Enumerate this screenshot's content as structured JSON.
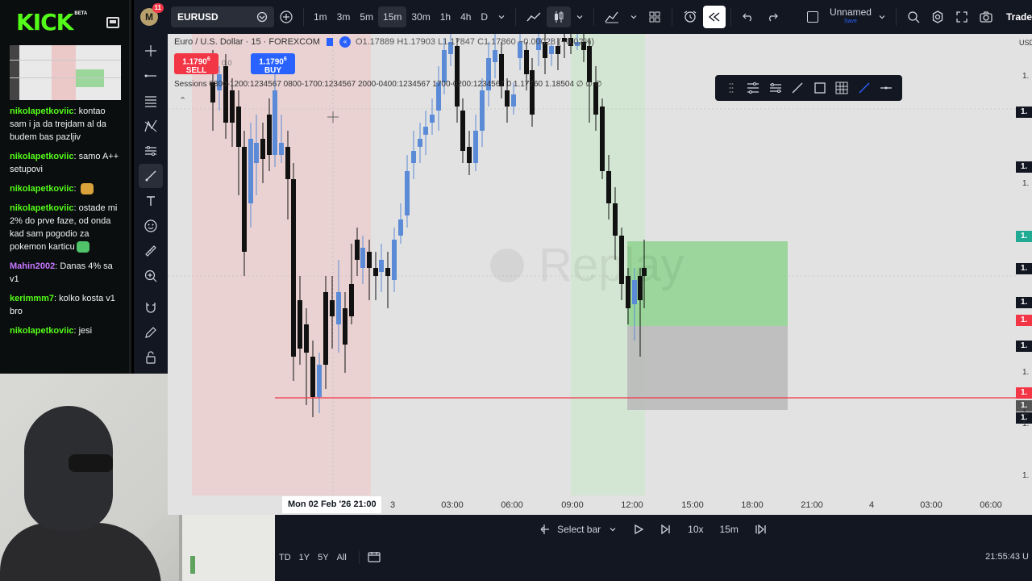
{
  "kick": {
    "logo": "KICK",
    "beta": "BETA",
    "chat": [
      {
        "user": "nikolapetkoviic",
        "color": "#53fc18",
        "text": "kontao sam i ja da trejdam al da budem bas pazljiv"
      },
      {
        "user": "nikolapetkoviic",
        "color": "#53fc18",
        "text": "samo A++ setupovi"
      },
      {
        "user": "nikolapetkoviic",
        "color": "#53fc18",
        "text": ""
      },
      {
        "user": "nikolapetkoviic",
        "color": "#53fc18",
        "text": "ostade mi 2% do prve faze, od onda kad sam pogodio za pokemon karticu"
      },
      {
        "user": "Mahin2002",
        "color": "#c678ff",
        "text": "Danas 4% sa v1"
      },
      {
        "user": "kerimmm7",
        "color": "#53fc18",
        "text": "kolko kosta v1 bro"
      },
      {
        "user": "nikolapetkoviic",
        "color": "#53fc18",
        "text": "jesi"
      }
    ]
  },
  "topbar": {
    "avatar_letter": "M",
    "notifications": "11",
    "symbol": "EURUSD",
    "intervals": [
      "1m",
      "3m",
      "5m",
      "15m",
      "30m",
      "1h",
      "4h",
      "D"
    ],
    "active_interval": "15m",
    "layout_name": "Unnamed",
    "layout_sub": "Save",
    "trade_label": "Trade"
  },
  "chart": {
    "title": "Euro / U.S. Dollar · 15 · FOREXCOM",
    "ohlc": {
      "o": "O1.17889",
      "h": "H1.17903",
      "l": "L1.17847",
      "c": "C1.17860",
      "change": "−0.00028 (−0.02%)"
    },
    "sell": {
      "price": "1.1790",
      "sup": "6",
      "label": "SELL"
    },
    "buy": {
      "price": "1.1790",
      "sup": "6",
      "label": "BUY"
    },
    "spread": "0.0",
    "sessions": "Sessions 0300-1200:1234567 0800-1700:1234567 2000-0400:1234567 1700-0200:1234567  0  1.17760  1.18504  ∅  ∅  ∅",
    "watermark": "Replay",
    "price_unit": "USD",
    "price_labels": [
      {
        "text": "1.",
        "bg": "#131722",
        "color": "#fff"
      },
      {
        "text": "1.",
        "bg": "#131722",
        "color": "#fff"
      },
      {
        "text": "1.",
        "bg": "#22ab94",
        "color": "#fff"
      },
      {
        "text": "1.",
        "bg": "#131722",
        "color": "#fff"
      },
      {
        "text": "1.",
        "bg": "#131722",
        "color": "#fff"
      },
      {
        "text": "1.",
        "bg": "#f23645",
        "color": "#fff"
      },
      {
        "text": "1.",
        "bg": "#131722",
        "color": "#fff"
      },
      {
        "text": "1.",
        "bg": "#f23645",
        "color": "#fff"
      },
      {
        "text": "1.",
        "bg": "#555",
        "color": "#fff"
      },
      {
        "text": "1.",
        "bg": "#131722",
        "color": "#fff"
      }
    ],
    "price_ticks": [
      "1.",
      "1.",
      "1.",
      "1.",
      "1.",
      "1."
    ],
    "time_labels": [
      "3",
      "03:00",
      "06:00",
      "09:00",
      "12:00",
      "15:00",
      "18:00",
      "21:00",
      "4",
      "03:00",
      "06:00"
    ],
    "current_time": "Mon 02 Feb '26   21:00",
    "colors": {
      "up": "#5b8bd6",
      "down": "#111111",
      "long_target": "#8fd48f",
      "long_stop": "#b8b8b8",
      "red_line": "#f23645",
      "session_red": "#f0c4c4",
      "session_green": "#cfe6cf"
    }
  },
  "replay": {
    "select_bar": "Select bar",
    "speed": "10x",
    "interval": "15m"
  },
  "bottom": {
    "ranges": [
      "TD",
      "1Y",
      "5Y",
      "All"
    ],
    "clock": "21:55:43 U"
  }
}
